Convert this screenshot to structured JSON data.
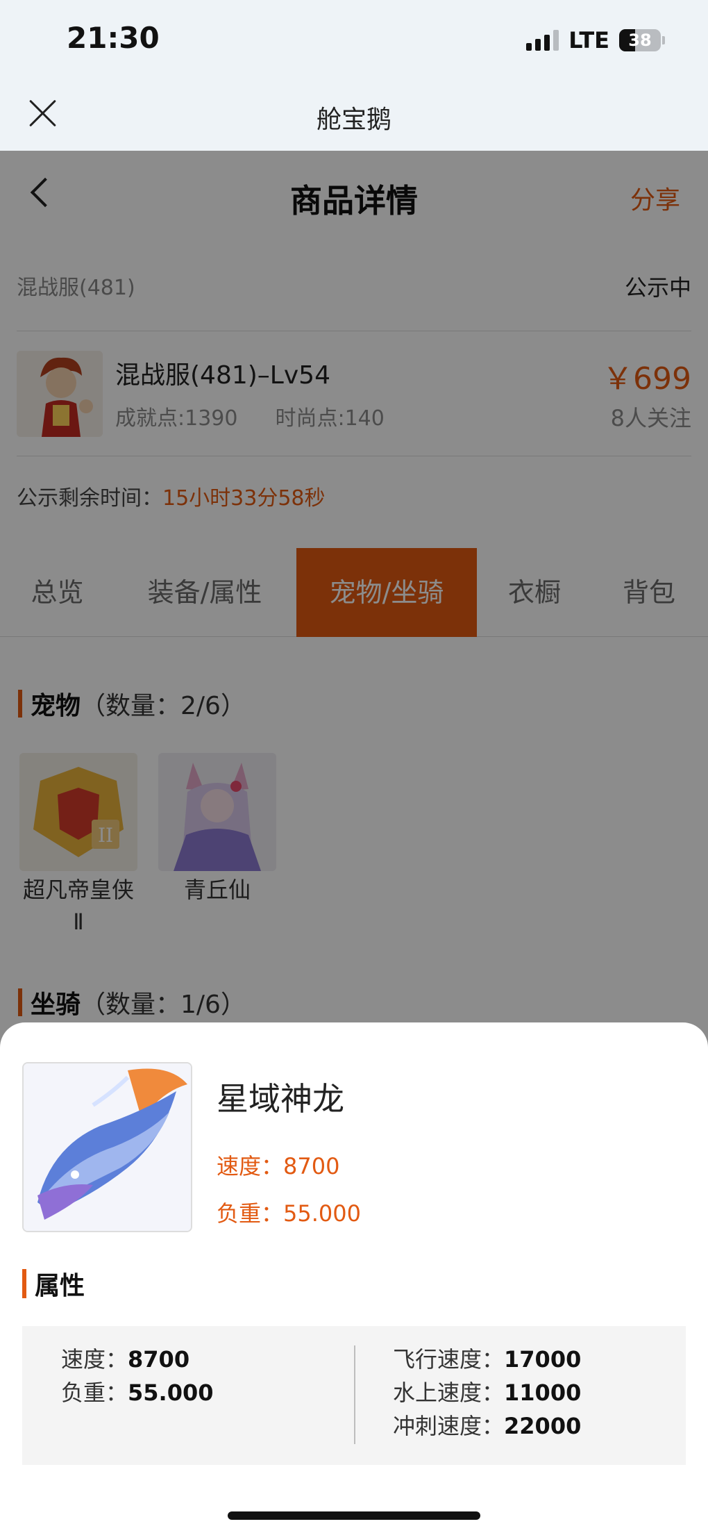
{
  "status_bar": {
    "time": "21:30",
    "network": "LTE",
    "battery": "38"
  },
  "app_bar": {
    "title": "舱宝鹅"
  },
  "nav": {
    "title": "商品详情",
    "share": "分享"
  },
  "server_row": {
    "server": "混战服(481)",
    "status": "公示中"
  },
  "item": {
    "name": "混战服(481)–Lv54",
    "achievement": "成就点:1390",
    "fashion": "时尚点:140",
    "price": "￥699",
    "watchers": "8人关注"
  },
  "countdown": {
    "label": "公示剩余时间：",
    "value": "15小时33分58秒"
  },
  "tabs": [
    "总览",
    "装备/属性",
    "宠物/坐骑",
    "衣橱",
    "背包"
  ],
  "active_tab_index": 2,
  "pets_section": {
    "title": "宠物",
    "count": "（数量：2/6）",
    "items": [
      {
        "name": "超凡帝皇侠Ⅱ"
      },
      {
        "name": "青丘仙"
      }
    ]
  },
  "mounts_section": {
    "title": "坐骑",
    "count": "（数量：1/6）"
  },
  "mount_detail": {
    "name": "星域神龙",
    "speed": "速度：8700",
    "load": "负重：55.000",
    "attr_title": "属性",
    "attrs_left": [
      {
        "key": "速度：",
        "value": "8700"
      },
      {
        "key": "负重：",
        "value": "55.000"
      }
    ],
    "attrs_right": [
      {
        "key": "飞行速度：",
        "value": "17000"
      },
      {
        "key": "水上速度：",
        "value": "11000"
      },
      {
        "key": "冲刺速度：",
        "value": "22000"
      }
    ]
  },
  "colors": {
    "accent": "#e25a12",
    "overlay": "rgba(0,0,0,0.45)"
  }
}
